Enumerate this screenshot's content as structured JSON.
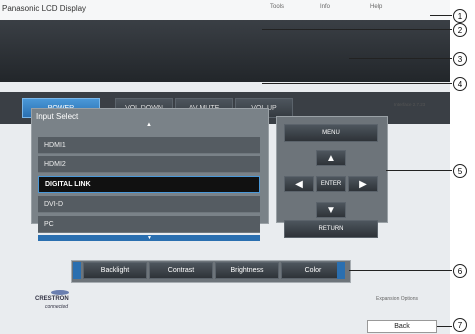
{
  "window": {
    "title": "Panasonic LCD Display"
  },
  "topmenu": {
    "tools": "Tools",
    "info": "Info",
    "help": "Help"
  },
  "controls": {
    "power": "POWER",
    "vol_down": "VOL DOWN",
    "av_mute": "AV MUTE",
    "vol_up": "VOL UP"
  },
  "interface_version": "Interface 2.7.23",
  "input_select": {
    "title": "Input Select",
    "items": [
      "HDMI1",
      "HDMI2",
      "DIGITAL LINK",
      "DVI-D",
      "PC"
    ],
    "selected": "DIGITAL LINK"
  },
  "navigation": {
    "menu": "MENU",
    "enter": "ENTER",
    "return": "RETURN"
  },
  "adjustments": {
    "labels": [
      "Backlight",
      "Contrast",
      "Brightness",
      "Color"
    ]
  },
  "footer": {
    "logo_text": "CRESTRON",
    "logo_sub": "connected",
    "expansion": "Expansion Options",
    "back": "Back"
  },
  "callouts": [
    "1",
    "2",
    "3",
    "4",
    "5",
    "6",
    "7"
  ]
}
